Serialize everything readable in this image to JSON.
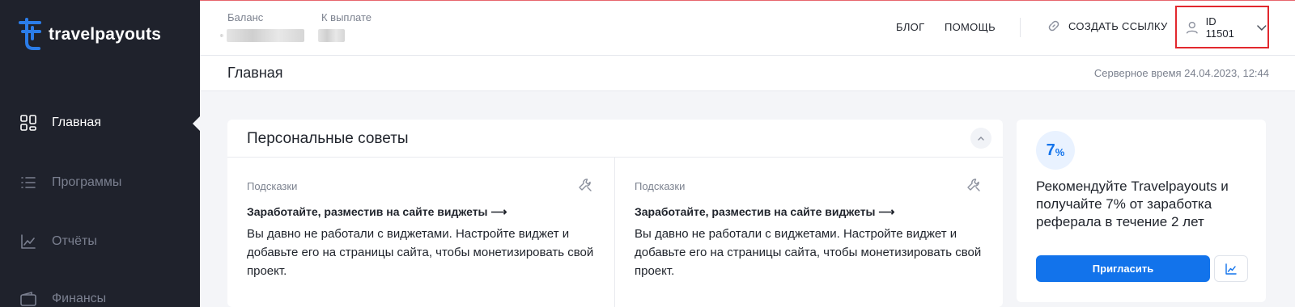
{
  "brand": {
    "name": "travelpayouts",
    "accent": "#1273eb"
  },
  "sidebar": {
    "items": [
      {
        "label": "Главная",
        "icon": "dashboard-icon",
        "active": true
      },
      {
        "label": "Программы",
        "icon": "list-icon",
        "active": false
      },
      {
        "label": "Отчёты",
        "icon": "chart-icon",
        "active": false
      },
      {
        "label": "Финансы",
        "icon": "wallet-icon",
        "active": false
      }
    ]
  },
  "header": {
    "balance_label": "Баланс",
    "payout_label": "К выплате",
    "nav": {
      "blog": "БЛОГ",
      "help": "ПОМОЩЬ"
    },
    "create_link": "СОЗДАТЬ ССЫЛКУ",
    "account_id": "ID 11501"
  },
  "page": {
    "title": "Главная",
    "server_time": "Серверное время 24.04.2023, 12:44"
  },
  "tips": {
    "title": "Персональные советы",
    "items": [
      {
        "category": "Подсказки",
        "headline": "Заработайте, разместив на сайте виджеты ⟶",
        "body": "Вы давно не работали с виджетами. Настройте виджет и добавьте его на страницы сайта, чтобы монетизировать свой проект."
      },
      {
        "category": "Подсказки",
        "headline": "Заработайте, разместив на сайте виджеты ⟶",
        "body": "Вы давно не работали с виджетами. Настройте виджет и добавьте его на страницы сайта, чтобы монетизировать свой проект."
      }
    ]
  },
  "promo": {
    "badge_number": "7",
    "badge_percent": "%",
    "text": "Рекомендуйте Travelpayouts и получайте 7% от заработка реферала в течение 2 лет",
    "invite_label": "Пригласить"
  }
}
